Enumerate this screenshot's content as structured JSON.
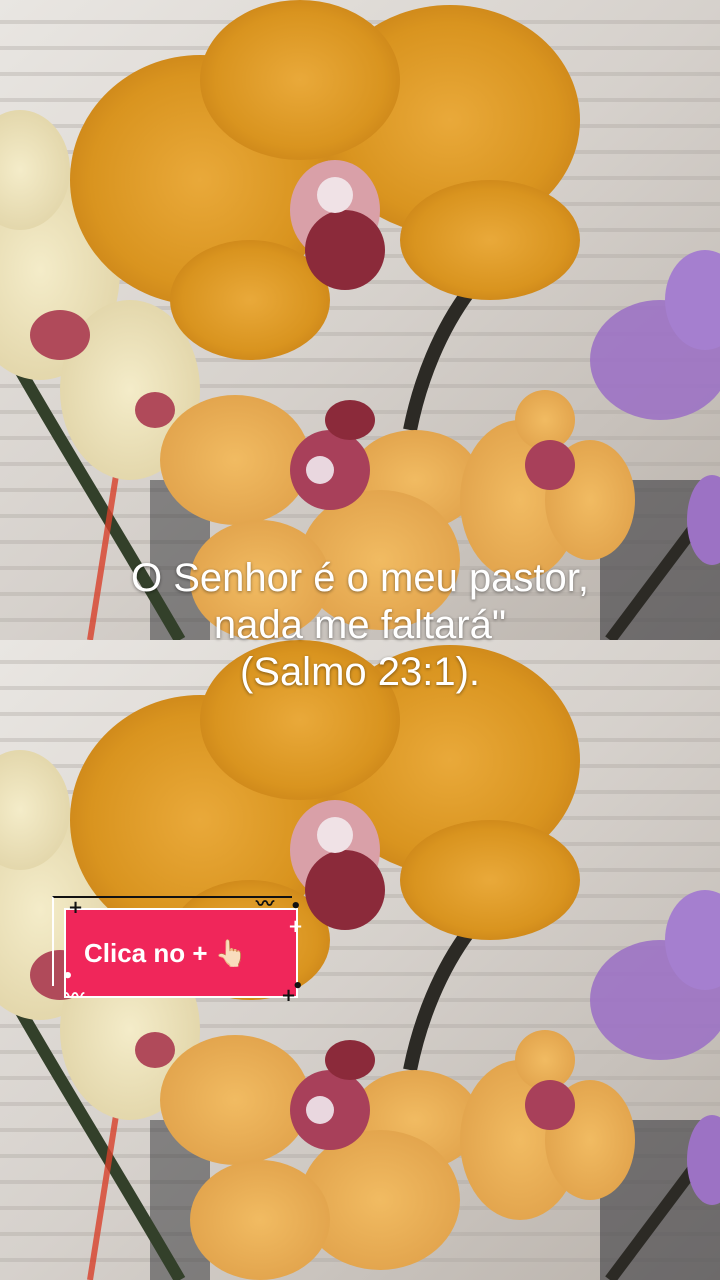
{
  "caption": {
    "line1": "O Senhor é o meu pastor,",
    "line2": "nada me faltará\"",
    "line3": "(Salmo 23:1)."
  },
  "cta": {
    "label": "Clica no + 👆🏻",
    "accent": "#f0265a"
  },
  "icons": {
    "plus": "+",
    "zigzag": "〰",
    "dot": "•"
  }
}
